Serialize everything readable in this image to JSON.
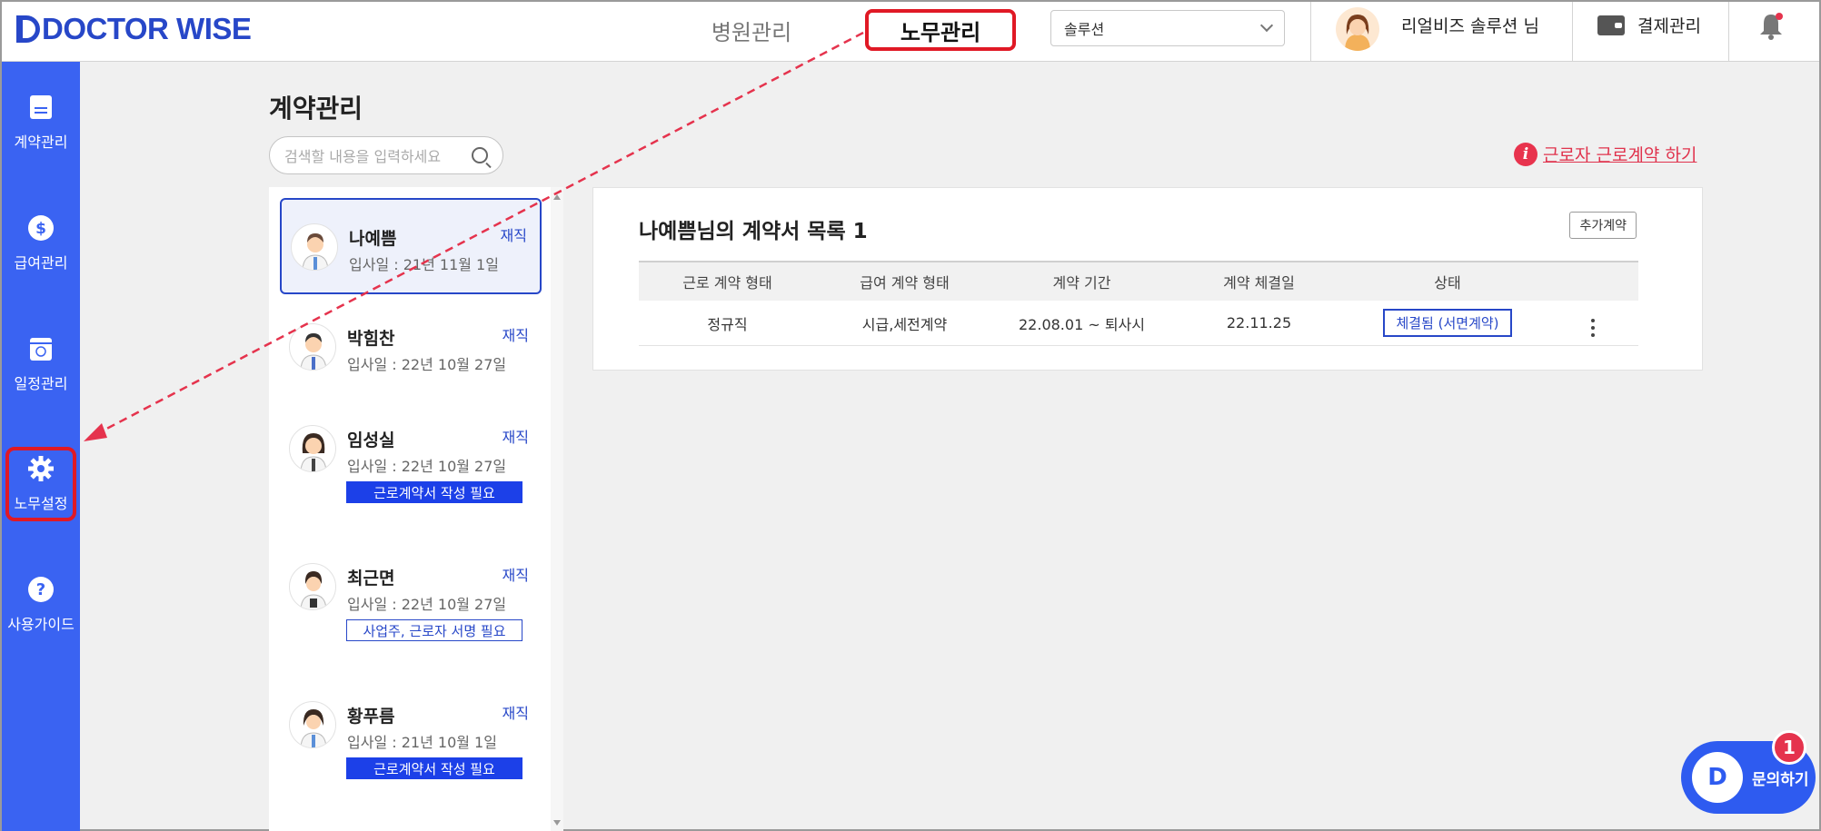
{
  "header": {
    "logo": "DOCTOR WISE",
    "nav": {
      "hospital": "병원관리",
      "labor": "노무관리"
    },
    "select": "솔루션",
    "user_name": "리얼비즈 솔루션 님",
    "payment": "결제관리"
  },
  "sidebar": {
    "items": [
      {
        "label": "계약관리",
        "icon": "document-icon"
      },
      {
        "label": "급여관리",
        "icon": "dollar-icon"
      },
      {
        "label": "일정관리",
        "icon": "calendar-icon"
      },
      {
        "label": "노무설정",
        "icon": "gear-icon"
      },
      {
        "label": "사용가이드",
        "icon": "question-icon"
      }
    ]
  },
  "main": {
    "title": "계약관리",
    "search_placeholder": "검색할 내용을 입력하세요",
    "warning_link": "근로자 근로계약 하기",
    "employees": [
      {
        "name": "나예쁨",
        "date": "입사일 : 21년 11월 1일",
        "status": "재직",
        "tag": ""
      },
      {
        "name": "박힘찬",
        "date": "입사일 : 22년 10월 27일",
        "status": "재직",
        "tag": ""
      },
      {
        "name": "임성실",
        "date": "입사일 : 22년 10월 27일",
        "status": "재직",
        "tag": "근로계약서 작성 필요"
      },
      {
        "name": "최근면",
        "date": "입사일 : 22년 10월 27일",
        "status": "재직",
        "tag": "사업주, 근로자 서명 필요"
      },
      {
        "name": "황푸름",
        "date": "입사일 : 21년 10월 1일",
        "status": "재직",
        "tag": "근로계약서 작성 필요"
      }
    ],
    "panel": {
      "title": "나예쁨님의 계약서 목록 1",
      "add_button": "추가계약",
      "columns": [
        "근로 계약 형태",
        "급여 계약 형태",
        "계약 기간",
        "계약 체결일",
        "상태"
      ],
      "rows": [
        {
          "type": "정규직",
          "pay": "시급,세전계약",
          "period": "22.08.01 ~ 퇴사시",
          "signed": "22.11.25",
          "status": "체결됨 (서면계약)"
        }
      ]
    }
  },
  "chat": {
    "label": "문의하기",
    "badge": "1"
  },
  "colors": {
    "brand": "#2747c8",
    "sidebar": "#3a63f2",
    "highlight": "#e01925",
    "warning": "#e0334d"
  }
}
